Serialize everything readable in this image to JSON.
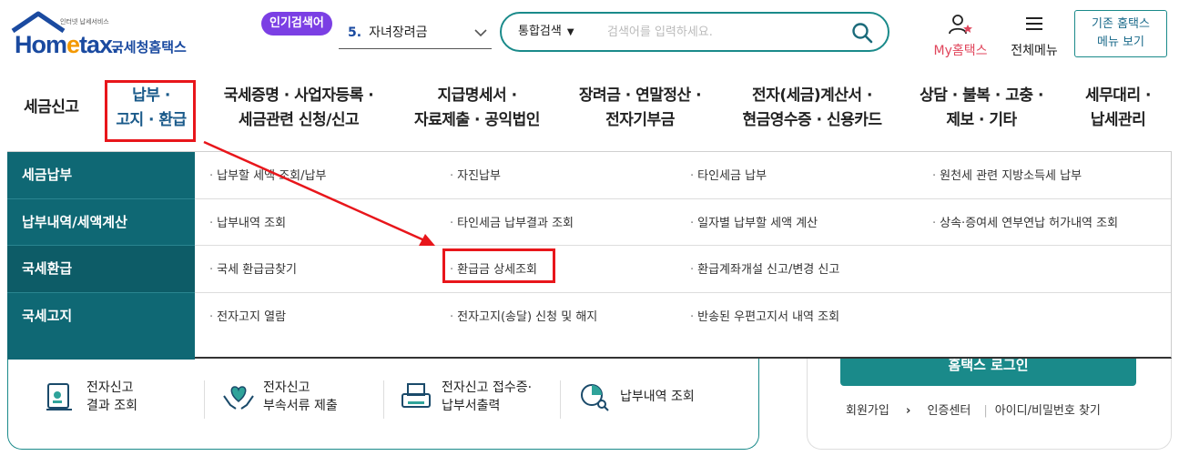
{
  "brand": {
    "tagline": "인터넷 납세서비스",
    "name_ho": "Hom",
    "name_e": "e",
    "name_tax": "tax.",
    "name_kr": "국세청홈택스"
  },
  "header": {
    "popular_badge": "인기검색어",
    "popular_rank": "5.",
    "popular_keyword": "자녀장려금",
    "search_category": "통합검색",
    "search_placeholder": "검색어를 입력하세요.",
    "my_hometax": "My홈택스",
    "all_menu": "전체메뉴",
    "old_home_line1": "기존 홈택스",
    "old_home_line2": "메뉴 보기"
  },
  "nav": {
    "tax_report": "세금신고",
    "payment_1": "납부 ·",
    "payment_2": "고지 · 환급",
    "cert_1": "국세증명 · 사업자등록 ·",
    "cert_2": "세금관련 신청/신고",
    "statement_1": "지급명세서 ·",
    "statement_2": "자료제출 · 공익법인",
    "incentive_1": "장려금 · 연말정산 ·",
    "incentive_2": "전자기부금",
    "einvoice_1": "전자(세금)계산서 ·",
    "einvoice_2": "현금영수증 · 신용카드",
    "consult_1": "상담 · 불복 · 고충 ·",
    "consult_2": "제보 · 기타",
    "agent_1": "세무대리 ·",
    "agent_2": "납세관리"
  },
  "mega": {
    "categories": [
      "세금납부",
      "납부내역/세액계산",
      "국세환급",
      "국세고지"
    ],
    "rows": [
      [
        "납부할 세액 조회/납부",
        "자진납부",
        "타인세금 납부",
        "원천세 관련 지방소득세 납부"
      ],
      [
        "납부내역 조회",
        "타인세금 납부결과 조회",
        "일자별 납부할 세액 계산",
        "상속·증여세 연부연납 허가내역 조회"
      ],
      [
        "국세 환급금찾기",
        "환급금 상세조회",
        "환급계좌개설 신고/변경 신고",
        ""
      ],
      [
        "전자고지 열람",
        "전자고지(송달) 신청 및 해지",
        "반송된 우편고지서 내역 조회",
        ""
      ]
    ]
  },
  "quick": {
    "q1_line1": "전자신고",
    "q1_line2": "결과 조회",
    "q2_line1": "전자신고",
    "q2_line2": "부속서류 제출",
    "q3_line1": "전자신고 접수증·",
    "q3_line2": "납부서출력",
    "q4_line1": "납부내역 조회"
  },
  "login": {
    "button": "홈택스 로그인",
    "signup": "회원가입",
    "cert_center": "인증센터",
    "find_id": "아이디/비밀번호 찾기"
  },
  "colors": {
    "brand_blue": "#1a4aa0",
    "teal": "#0f6874",
    "highlight_red": "#e8161b",
    "badge_purple": "#7b3fe4"
  }
}
